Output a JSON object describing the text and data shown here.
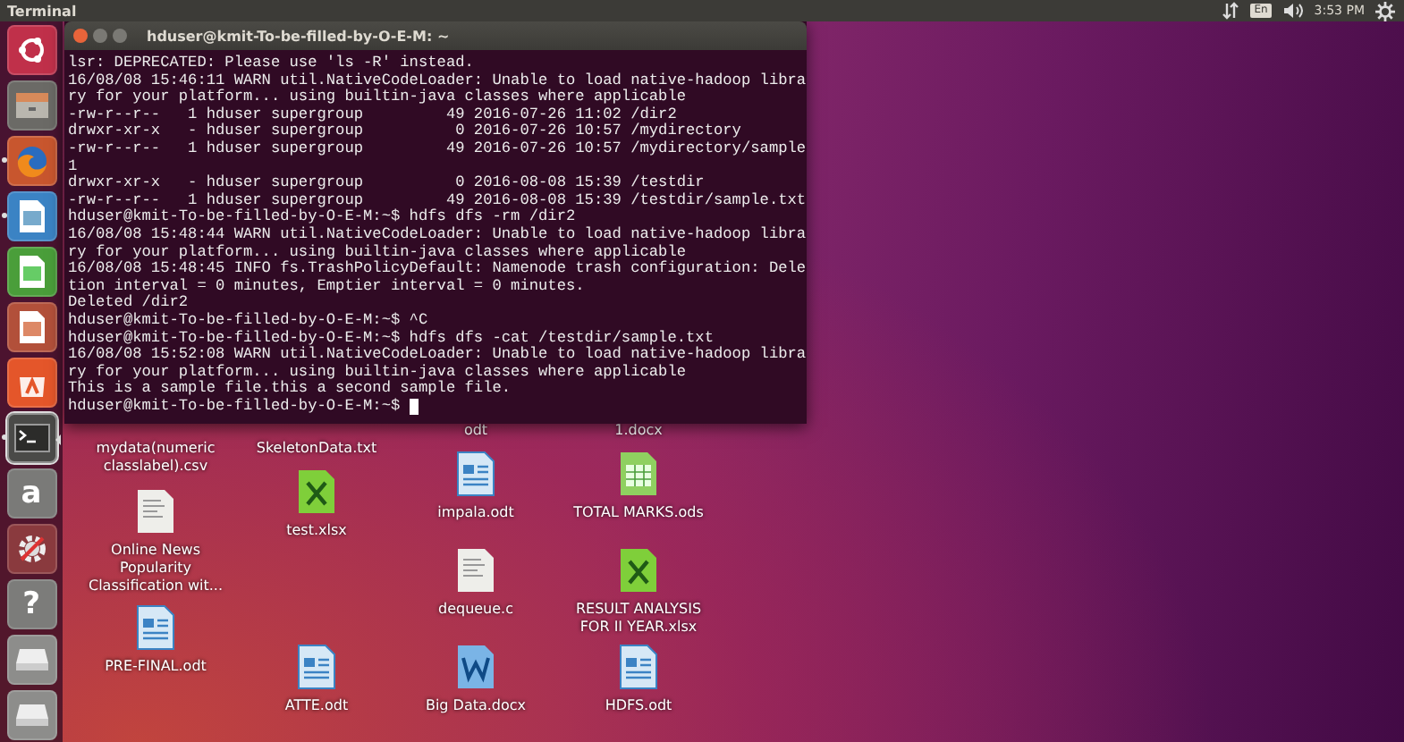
{
  "top_bar": {
    "app_title": "Terminal",
    "keyboard": "En",
    "time": "3:53 PM"
  },
  "launcher": [
    {
      "kind": "ubuntu",
      "selected": false,
      "running": false
    },
    {
      "kind": "files",
      "selected": false,
      "running": false
    },
    {
      "kind": "firefox",
      "selected": false,
      "running": true
    },
    {
      "kind": "writer",
      "selected": false,
      "running": true
    },
    {
      "kind": "calc",
      "selected": false,
      "running": false
    },
    {
      "kind": "impress",
      "selected": false,
      "running": false
    },
    {
      "kind": "software",
      "selected": false,
      "running": false
    },
    {
      "kind": "terminal",
      "selected": true,
      "running": true
    },
    {
      "kind": "amazon",
      "selected": false,
      "running": false,
      "glyph": "a"
    },
    {
      "kind": "settings",
      "selected": false,
      "running": false
    },
    {
      "kind": "help",
      "selected": false,
      "running": false,
      "glyph": "?"
    },
    {
      "kind": "drive",
      "selected": false,
      "running": false
    },
    {
      "kind": "drive",
      "selected": false,
      "running": false
    }
  ],
  "desktop_icons": [
    {
      "kind": "covered",
      "label": "odt"
    },
    {
      "kind": "covered",
      "label": "1.docx"
    },
    {
      "kind": "covered",
      "label": "mydata(numeric classlabel).csv"
    },
    {
      "kind": "covered",
      "label": "SkeletonData.txt"
    },
    {
      "kind": "writer",
      "label": "impala.odt"
    },
    {
      "kind": "calc",
      "label": "TOTAL MARKS.ods"
    },
    {
      "kind": "excel",
      "label": "test.xlsx"
    },
    {
      "kind": "text",
      "label": "Online News Popularity Classification wit..."
    },
    {
      "kind": "text",
      "label": "dequeue.c"
    },
    {
      "kind": "excel",
      "label": "RESULT ANALYSIS FOR II YEAR.xlsx"
    },
    {
      "kind": "writer",
      "label": "PRE-FINAL.odt"
    },
    {
      "kind": "writer",
      "label": "ATTE.odt"
    },
    {
      "kind": "word",
      "label": "Big Data.docx"
    },
    {
      "kind": "writer",
      "label": "HDFS.odt"
    }
  ],
  "terminal": {
    "title": "hduser@kmit-To-be-filled-by-O-E-M: ~",
    "cursor": true,
    "lines": [
      "lsr: DEPRECATED: Please use 'ls -R' instead.",
      "16/08/08 15:46:11 WARN util.NativeCodeLoader: Unable to load native-hadoop libra",
      "ry for your platform... using builtin-java classes where applicable",
      "-rw-r--r--   1 hduser supergroup         49 2016-07-26 11:02 /dir2",
      "drwxr-xr-x   - hduser supergroup          0 2016-07-26 10:57 /mydirectory",
      "-rw-r--r--   1 hduser supergroup         49 2016-07-26 10:57 /mydirectory/sample",
      "1",
      "drwxr-xr-x   - hduser supergroup          0 2016-08-08 15:39 /testdir",
      "-rw-r--r--   1 hduser supergroup         49 2016-08-08 15:39 /testdir/sample.txt",
      "hduser@kmit-To-be-filled-by-O-E-M:~$ hdfs dfs -rm /dir2",
      "16/08/08 15:48:44 WARN util.NativeCodeLoader: Unable to load native-hadoop libra",
      "ry for your platform... using builtin-java classes where applicable",
      "16/08/08 15:48:45 INFO fs.TrashPolicyDefault: Namenode trash configuration: Dele",
      "tion interval = 0 minutes, Emptier interval = 0 minutes.",
      "Deleted /dir2",
      "hduser@kmit-To-be-filled-by-O-E-M:~$ ^C",
      "hduser@kmit-To-be-filled-by-O-E-M:~$ hdfs dfs -cat /testdir/sample.txt",
      "16/08/08 15:52:08 WARN util.NativeCodeLoader: Unable to load native-hadoop libra",
      "ry for your platform... using builtin-java classes where applicable",
      "This is a sample file.this a second sample file.",
      "hduser@kmit-To-be-filled-by-O-E-M:~$"
    ]
  }
}
